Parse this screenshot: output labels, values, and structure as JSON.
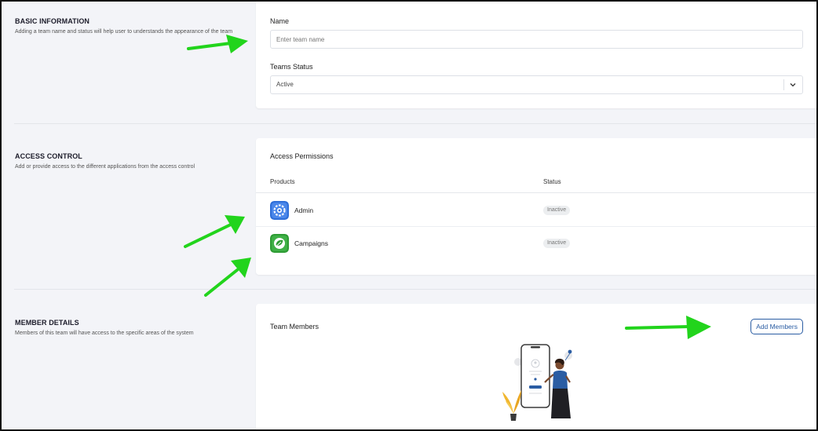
{
  "basic_info": {
    "title": "BASIC INFORMATION",
    "description": "Adding a team name and status will help user to understands the appearance of the team",
    "name_label": "Name",
    "name_placeholder": "Enter team name",
    "status_label": "Teams Status",
    "status_value": "Active"
  },
  "access_control": {
    "title": "ACCESS CONTROL",
    "description": "Add or provide access to the different applications from the access control",
    "card_title": "Access Permissions",
    "columns": [
      "Products",
      "Status"
    ],
    "rows": [
      {
        "product": "Admin",
        "status": "Inactive",
        "icon": "admin-gear-icon",
        "color": "#2f6fd8"
      },
      {
        "product": "Campaigns",
        "status": "Inactive",
        "icon": "campaigns-leaf-icon",
        "color": "#2e9c34"
      }
    ]
  },
  "member_details": {
    "title": "MEMBER DETAILS",
    "description": "Members of this team will have access to the specific areas of the system",
    "card_title": "Team Members",
    "add_button": "Add Members"
  },
  "colors": {
    "accent": "#2b5da3",
    "arrow": "#22d41c",
    "background": "#f3f4f8"
  }
}
